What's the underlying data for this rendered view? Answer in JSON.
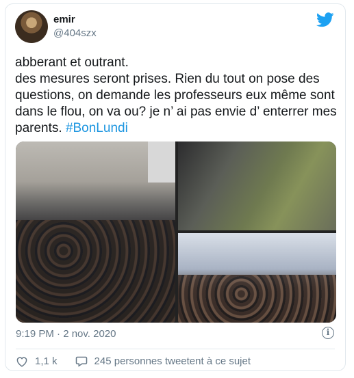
{
  "user": {
    "name": "emir",
    "handle": "@404szx"
  },
  "tweet": {
    "lines": [
      "abberant et outrant.",
      "des mesures seront prises. Rien du tout on pose des questions, on demande les professeurs eux même sont dans le flou, on va ou? je n’ ai pas envie d’ enterrer mes parents."
    ],
    "hashtag": "#BonLundi"
  },
  "timestamp": "9:19 PM · 2 nov. 2020",
  "actions": {
    "likes": "1,1 k",
    "retweets_text": "245 personnes tweetent à ce sujet"
  },
  "icons": [
    "twitter-bird-icon",
    "info-icon",
    "heart-icon",
    "comment-icon"
  ],
  "colors": {
    "link": "#1b95e0",
    "secondary_text": "#657786",
    "border": "#e1e8ed"
  }
}
